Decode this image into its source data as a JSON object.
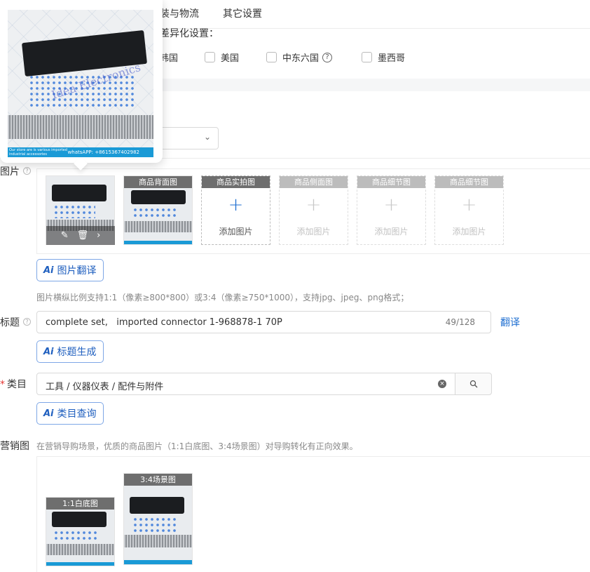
{
  "tabs": {
    "logistics": "装与物流",
    "other_settings": "其它设置"
  },
  "diff_section": {
    "title": "差异化设置：",
    "countries": [
      {
        "label": "韩国"
      },
      {
        "label": "美国"
      },
      {
        "label": "中东六国"
      },
      {
        "label": "墨西哥"
      }
    ]
  },
  "images": {
    "label": "图片",
    "slots": [
      {
        "caption": "",
        "state": "filled"
      },
      {
        "caption": "商品背面图",
        "state": "filled"
      },
      {
        "caption": "商品实拍图",
        "state": "add",
        "add_text": "添加图片"
      },
      {
        "caption": "商品侧面图",
        "state": "disabled",
        "add_text": "添加图片"
      },
      {
        "caption": "商品细节图",
        "state": "disabled",
        "add_text": "添加图片"
      },
      {
        "caption": "商品细节图",
        "state": "disabled",
        "add_text": "添加图片"
      }
    ],
    "translate_button": "图片翻译",
    "hint": "图片横纵比例支持1:1（像素≥800*800）或3:4（像素≥750*1000），支持jpg、jpeg、png格式；"
  },
  "title_field": {
    "label": "标题",
    "value": "complete set,   imported connector 1-968878-1 70P",
    "counter": "49/128",
    "translate_link": "翻译",
    "generate_button": "标题生成"
  },
  "category_field": {
    "label": "类目",
    "required": "*",
    "value": "工具 / 仪器仪表 / 配件与附件",
    "query_button": "类目查询"
  },
  "marketing": {
    "label": "营销图",
    "hint": "在营销导购场景，优质的商品图片（1:1白底图、3:4场景图）对导购转化有正向效果。",
    "tag_square": "1:1白底图",
    "tag_scene": "3:4场景图"
  },
  "watermark": {
    "brand": "Idea Electronics",
    "bottom_text": "Our store are is various imported industrial accessories",
    "phone": "whatsAPP: +8615367402982"
  },
  "colors": {
    "accent": "#1f6fd1",
    "required": "#e53935",
    "caption_bg": "#6e6e6e"
  },
  "icons": {
    "edit": "pencil-icon",
    "delete": "trash-icon",
    "next": "chevron-right-icon",
    "clear": "clear-circle-icon",
    "search": "search-icon",
    "help": "question-circle-icon",
    "dropdown": "chevron-down-icon"
  }
}
